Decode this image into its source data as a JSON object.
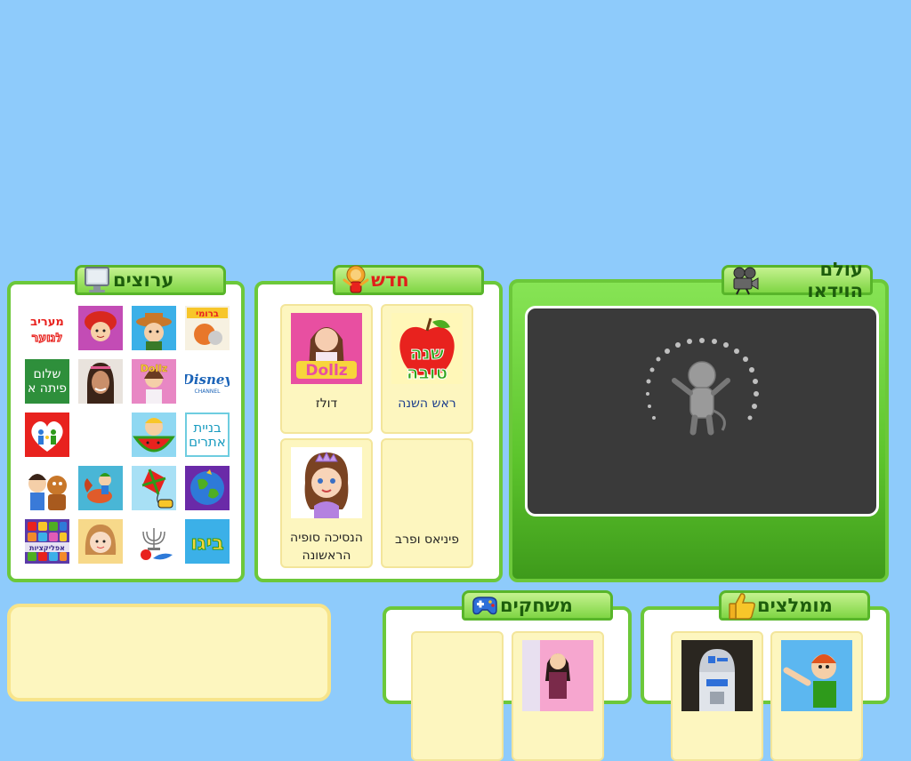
{
  "sections": {
    "video": {
      "title": "עולם הוידאו",
      "icon": "movie-camera-icon"
    },
    "new": {
      "title": "חדש",
      "icon": "lion-mascot-icon"
    },
    "channels": {
      "title": "ערוצים",
      "icon": "computer-monitor-icon"
    },
    "recommended": {
      "title": "מומלצים",
      "icon": "thumbs-up-icon"
    },
    "games": {
      "title": "משחקים",
      "icon": "gamepad-icon"
    }
  },
  "new_items": [
    {
      "label": "ראש השנה",
      "thumb_text": "שנה טובה"
    },
    {
      "label": "דולז",
      "thumb_text": "Dollz"
    },
    {
      "label": "פיניאס ופרב",
      "thumb_text": ""
    },
    {
      "label": "הנסיכה סופיה הראשונה",
      "thumb_text": ""
    }
  ],
  "channels": [
    {
      "name": "bromi-channel",
      "text": "ברומי"
    },
    {
      "name": "cowboy-kid-channel",
      "text": ""
    },
    {
      "name": "red-hat-girl-channel",
      "text": ""
    },
    {
      "name": "maariv-youth-channel",
      "text": "מעריב לנוער"
    },
    {
      "name": "disney-channel",
      "text": "Disney CHANNEL"
    },
    {
      "name": "dollz-channel",
      "text": "Dollz"
    },
    {
      "name": "girl-portrait-channel",
      "text": ""
    },
    {
      "name": "shalom-pita-channel",
      "text": "שלום פיתה א"
    },
    {
      "name": "site-building-channel",
      "text": "בניית אתרים"
    },
    {
      "name": "watermelon-kid-channel",
      "text": ""
    },
    {
      "name": "empty-channel",
      "text": ""
    },
    {
      "name": "family-heart-channel",
      "text": ""
    },
    {
      "name": "globe-channel",
      "text": ""
    },
    {
      "name": "kite-channel",
      "text": ""
    },
    {
      "name": "horse-rider-channel",
      "text": ""
    },
    {
      "name": "kids-animation-channel",
      "text": ""
    },
    {
      "name": "bigi-channel",
      "text": "ביגו"
    },
    {
      "name": "menorah-channel",
      "text": ""
    },
    {
      "name": "girl-cartoon-channel",
      "text": ""
    },
    {
      "name": "apps-channel",
      "text": "אפליקציות"
    }
  ],
  "colors": {
    "background": "#8ecbfb",
    "panel_border": "#6cc83a",
    "tab_green": "#7fd644",
    "card": "#fdf6bf"
  }
}
